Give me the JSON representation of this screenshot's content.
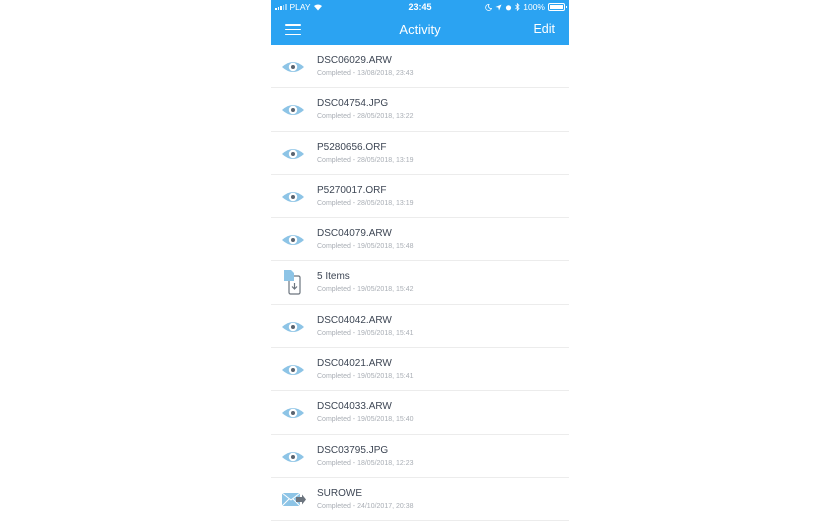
{
  "status_bar": {
    "carrier": "PLAY",
    "time": "23:45",
    "battery": "100%"
  },
  "nav": {
    "title": "Activity",
    "edit_label": "Edit"
  },
  "colors": {
    "accent": "#2ba3f2",
    "icon_blue": "#8dc4e6",
    "title_text": "#3d4654",
    "subtitle_text": "#a9aeb5"
  },
  "items": [
    {
      "icon": "eye-icon",
      "title": "DSC06029.ARW",
      "subtitle": "Completed - 13/08/2018, 23:43"
    },
    {
      "icon": "eye-icon",
      "title": "DSC04754.JPG",
      "subtitle": "Completed - 28/05/2018, 13:22"
    },
    {
      "icon": "eye-icon",
      "title": "P5280656.ORF",
      "subtitle": "Completed - 28/05/2018, 13:19"
    },
    {
      "icon": "eye-icon",
      "title": "P5270017.ORF",
      "subtitle": "Completed - 28/05/2018, 13:19"
    },
    {
      "icon": "eye-icon",
      "title": "DSC04079.ARW",
      "subtitle": "Completed - 19/05/2018, 15:48"
    },
    {
      "icon": "download-to-device-icon",
      "title": "5 Items",
      "subtitle": "Completed - 19/05/2018, 15:42"
    },
    {
      "icon": "eye-icon",
      "title": "DSC04042.ARW",
      "subtitle": "Completed - 19/05/2018, 15:41"
    },
    {
      "icon": "eye-icon",
      "title": "DSC04021.ARW",
      "subtitle": "Completed - 19/05/2018, 15:41"
    },
    {
      "icon": "eye-icon",
      "title": "DSC04033.ARW",
      "subtitle": "Completed - 19/05/2018, 15:40"
    },
    {
      "icon": "eye-icon",
      "title": "DSC03795.JPG",
      "subtitle": "Completed - 18/05/2018, 12:23"
    },
    {
      "icon": "mail-send-icon",
      "title": "SUROWE",
      "subtitle": "Completed - 24/10/2017, 20:38"
    }
  ]
}
